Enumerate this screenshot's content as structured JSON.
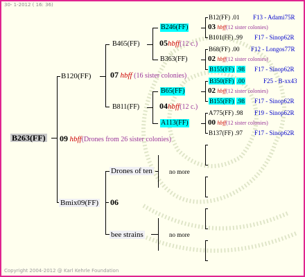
{
  "header": "30-  1-2012 ( 16: 36)",
  "footer": "Copyright 2004-2012 @ Karl Kehrle Foundation",
  "root": {
    "label": "B263(FF)",
    "num": "09",
    "hbff": "hbff",
    "desc": "(Drones from 26 sister colonies)"
  },
  "gen1": {
    "top": {
      "label": "B120(FF)",
      "num": "07",
      "hbff": "hbff",
      "desc": "(16 sister colonies)"
    },
    "bottom": {
      "label": "Bmix09(FF)",
      "num": "06"
    }
  },
  "gen2": [
    {
      "label": "B465(FF)",
      "num": "05",
      "hbff": "hbff",
      "desc": "(12 c.)"
    },
    {
      "label": "B811(FF)",
      "num": "04",
      "hbff": "hbff",
      "desc": "(12 c.)"
    },
    {
      "label": "Drones of ten"
    },
    {
      "label": "bee strains"
    }
  ],
  "gen3": [
    {
      "label": "B246(FF)",
      "num": "03",
      "hbff": "hbff",
      "desc": "(12 sister colonies)"
    },
    {
      "label": "B363(FF)",
      "num": "02",
      "hbff": "hbff",
      "desc": "(12 sister colonies)"
    },
    {
      "label": "B65(FF)",
      "num": "02",
      "hbff": "hbff",
      "desc": "(12 sister colonies)"
    },
    {
      "label": "A113(FF)",
      "num": "00",
      "hbff": "hbff",
      "desc": "(12 sister colonies)"
    }
  ],
  "gen4": [
    {
      "label": "B12(FF)",
      "val": ".01",
      "right": "F13 - Adami75R"
    },
    {
      "label": "B101(FF)",
      "val": ".99",
      "right": "F17 - Sinop62R"
    },
    {
      "label": "B68(FF)",
      "val": ".00",
      "right": "F12 - Longos77R"
    },
    {
      "label": "B155(FF)",
      "val": ".98",
      "right": "F17 - Sinop62R"
    },
    {
      "label": "B350(FF)",
      "val": ".00",
      "right": "F25 - B-xx43"
    },
    {
      "label": "B155(FF)",
      "val": ".98",
      "right": "F17 - Sinop62R"
    },
    {
      "label": "A775(FF)",
      "val": ".98",
      "right": "F19 - Sinop62R"
    },
    {
      "label": "B137(FF)",
      "val": ".97",
      "right": "F17 - Sinop62R"
    }
  ],
  "nomore": "no more"
}
